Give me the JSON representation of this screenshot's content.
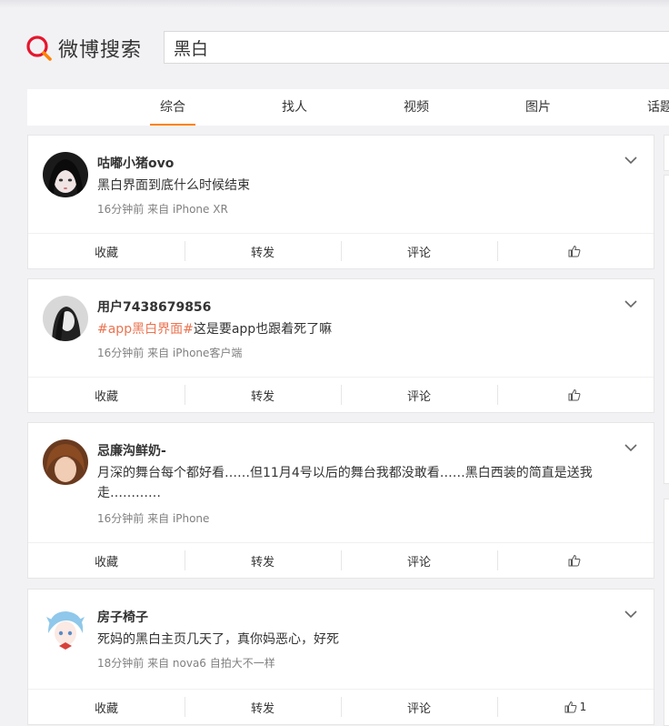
{
  "header": {
    "logo_text": "微博搜索",
    "search_value": "黑白"
  },
  "tabs": [
    {
      "label": "综合",
      "active": true
    },
    {
      "label": "找人",
      "active": false
    },
    {
      "label": "视频",
      "active": false
    },
    {
      "label": "图片",
      "active": false
    },
    {
      "label": "话题",
      "active": false
    }
  ],
  "colors": {
    "accent": "#ff8200",
    "topic_link": "#eb7350",
    "meta": "#808080"
  },
  "posts": [
    {
      "username": "咕嘟小猪ovo",
      "text": "黑白界面到底什么时候结束",
      "topic": "",
      "meta": "16分钟前  来自 iPhone XR",
      "actions": {
        "favorite": "收藏",
        "repost": "转发",
        "comment": "评论",
        "like_count": ""
      }
    },
    {
      "username": "用户7438679856",
      "topic": "#app黑白界面#",
      "text": "这是要app也跟着死了嘛",
      "meta": "16分钟前  来自 iPhone客户端",
      "actions": {
        "favorite": "收藏",
        "repost": "转发",
        "comment": "评论",
        "like_count": ""
      }
    },
    {
      "username": "忌廉沟鲜奶-",
      "topic": "",
      "text": "月深的舞台每个都好看……但11月4号以后的舞台我都没敢看……黑白西装的简直是送我走…………",
      "meta": "16分钟前  来自 iPhone",
      "actions": {
        "favorite": "收藏",
        "repost": "转发",
        "comment": "评论",
        "like_count": ""
      }
    },
    {
      "username": "房子椅子",
      "topic": "",
      "text": "死妈的黑白主页几天了，真你妈恶心，好死",
      "meta": "18分钟前  来自 nova6 自拍大不一样",
      "actions": {
        "favorite": "收藏",
        "repost": "转发",
        "comment": "评论",
        "like_count": "1"
      }
    }
  ]
}
